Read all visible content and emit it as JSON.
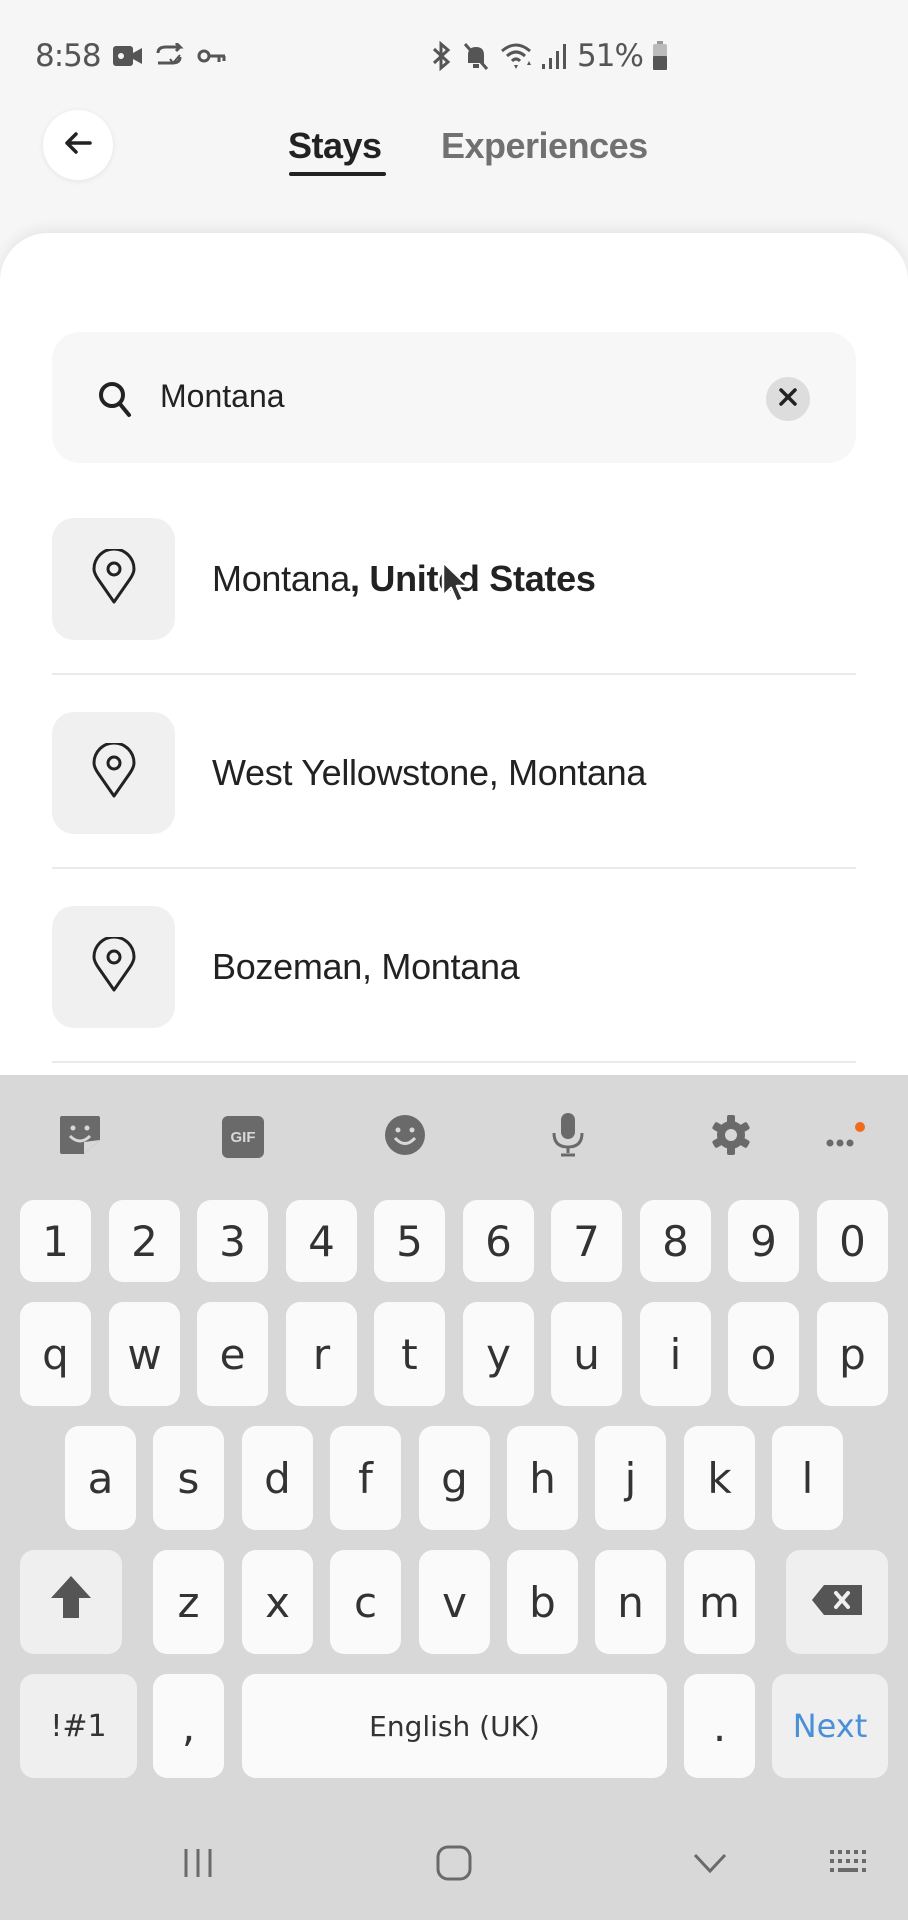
{
  "status_bar": {
    "time": "8:58",
    "left_icons": [
      "video-record-icon",
      "sync-check-icon",
      "vpn-key-icon"
    ],
    "right_icons": [
      "bluetooth-icon",
      "mute-icon",
      "wifi-icon",
      "signal-icon"
    ],
    "battery_percent": "51%",
    "battery_icon": "battery-icon"
  },
  "header": {
    "back_icon": "arrow-left-icon",
    "tabs": [
      {
        "label": "Stays",
        "selected": true
      },
      {
        "label": "Experiences",
        "selected": false
      }
    ]
  },
  "search": {
    "value": "Montana",
    "icon": "search-icon",
    "clear_icon": "close-icon"
  },
  "results": [
    {
      "icon": "map-pin-icon",
      "label_plain": "Montana",
      "label_bold": ", United States"
    },
    {
      "icon": "map-pin-icon",
      "label_plain": "West Yellowstone, Montana",
      "label_bold": ""
    },
    {
      "icon": "map-pin-icon",
      "label_plain": "Bozeman, Montana",
      "label_bold": ""
    }
  ],
  "keyboard": {
    "toolbar": [
      "sticker-icon",
      "gif-icon",
      "emoji-icon",
      "microphone-icon",
      "settings-icon",
      "more-icon"
    ],
    "gif_label": "GIF",
    "notification_dot_color": "#f26b1d",
    "number_row": [
      "1",
      "2",
      "3",
      "4",
      "5",
      "6",
      "7",
      "8",
      "9",
      "0"
    ],
    "row1": [
      "q",
      "w",
      "e",
      "r",
      "t",
      "y",
      "u",
      "i",
      "o",
      "p"
    ],
    "row2": [
      "a",
      "s",
      "d",
      "f",
      "g",
      "h",
      "j",
      "k",
      "l"
    ],
    "row3": [
      "z",
      "x",
      "c",
      "v",
      "b",
      "n",
      "m"
    ],
    "symbols_label": "!#1",
    "comma": ",",
    "space_label": "English (UK)",
    "period": ".",
    "action_label": "Next",
    "action_color": "#4a90d9"
  },
  "nav_bar": [
    "recent-apps-icon",
    "home-icon",
    "hide-keyboard-icon",
    "keyboard-switch-icon"
  ]
}
